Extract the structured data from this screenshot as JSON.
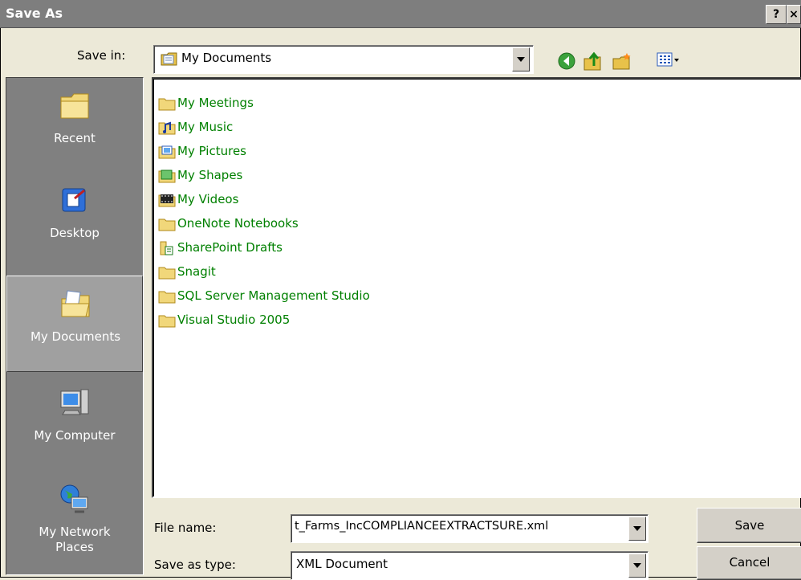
{
  "window": {
    "title": "Save As",
    "help_label": "?",
    "close_label": "×"
  },
  "save_in": {
    "label": "Save in:",
    "value": "My Documents"
  },
  "toolbar": {
    "icons": [
      "back-icon",
      "up-folder-icon",
      "new-folder-icon",
      "views-menu-icon"
    ]
  },
  "places": [
    {
      "label": "Recent",
      "icon": "folder-icon"
    },
    {
      "label": "Desktop",
      "icon": "desktop-icon"
    },
    {
      "label": "My Documents",
      "icon": "my-documents-icon",
      "selected": true
    },
    {
      "label": "My Computer",
      "icon": "my-computer-icon"
    },
    {
      "label": "My Network Places",
      "icon": "network-places-icon"
    }
  ],
  "files": [
    {
      "name": "My Meetings",
      "icon": "folder-icon"
    },
    {
      "name": "My Music",
      "icon": "music-folder-icon"
    },
    {
      "name": "My Pictures",
      "icon": "pictures-folder-icon"
    },
    {
      "name": "My Shapes",
      "icon": "shapes-folder-icon"
    },
    {
      "name": "My Videos",
      "icon": "videos-folder-icon"
    },
    {
      "name": "OneNote Notebooks",
      "icon": "folder-icon"
    },
    {
      "name": "SharePoint Drafts",
      "icon": "sharepoint-folder-icon"
    },
    {
      "name": "Snagit",
      "icon": "folder-icon"
    },
    {
      "name": "SQL Server Management Studio",
      "icon": "folder-icon"
    },
    {
      "name": "Visual Studio 2005",
      "icon": "folder-icon"
    }
  ],
  "file_name": {
    "label": "File name:",
    "value": "t_Farms_IncCOMPLIANCEEXTRACTSURE.xml"
  },
  "save_as_type": {
    "label": "Save as type:",
    "value": "XML Document"
  },
  "buttons": {
    "save": "Save",
    "cancel": "Cancel"
  },
  "colors": {
    "file_text": "#008000",
    "title_bar": "#7e7e7e",
    "places_bg": "#808080"
  }
}
